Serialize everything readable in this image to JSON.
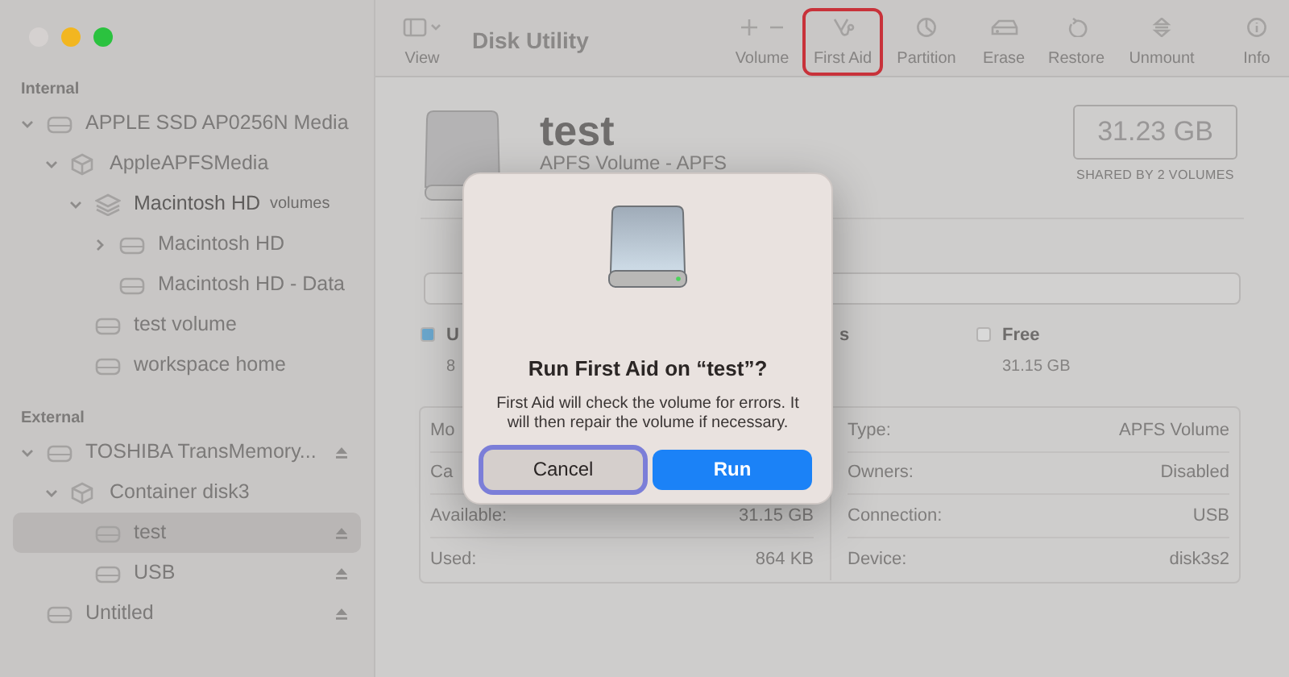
{
  "window": {
    "title": "Disk Utility",
    "controls": [
      {
        "color": "#d5d1d0"
      },
      {
        "color": "#f2b620"
      },
      {
        "color": "#2bc23f"
      }
    ]
  },
  "toolbar": {
    "view_label": "View",
    "buttons": [
      {
        "kind": "volume",
        "label": "Volume",
        "highlighted": false
      },
      {
        "kind": "first-aid",
        "label": "First Aid",
        "highlighted": true
      },
      {
        "kind": "partition",
        "label": "Partition",
        "highlighted": false
      },
      {
        "kind": "erase",
        "label": "Erase",
        "highlighted": false
      },
      {
        "kind": "restore",
        "label": "Restore",
        "highlighted": false
      },
      {
        "kind": "unmount",
        "label": "Unmount",
        "highlighted": false
      },
      {
        "kind": "info",
        "label": "Info",
        "highlighted": false
      }
    ]
  },
  "sidebar": {
    "sections": [
      {
        "title": "Internal",
        "items": [
          {
            "label": "APPLE SSD AP0256N Media",
            "kind": "drive",
            "expanded": true,
            "selected": false,
            "children": [
              {
                "label": "AppleAPFSMedia",
                "kind": "container",
                "expanded": true,
                "selected": false,
                "children": [
                  {
                    "label": "Macintosh HD",
                    "note": "volumes",
                    "kind": "group",
                    "expanded": true,
                    "selected": false,
                    "children": [
                      {
                        "label": "Macintosh HD",
                        "kind": "drive",
                        "expanded": false,
                        "selected": false
                      },
                      {
                        "label": "Macintosh HD - Data",
                        "kind": "drive",
                        "selected": false
                      }
                    ]
                  },
                  {
                    "label": "test volume",
                    "kind": "drive",
                    "selected": false
                  },
                  {
                    "label": "workspace home",
                    "kind": "drive",
                    "selected": false
                  }
                ]
              }
            ]
          }
        ]
      },
      {
        "title": "External",
        "items": [
          {
            "label": "TOSHIBA TransMemory...",
            "kind": "drive",
            "expanded": true,
            "ejectable": true,
            "selected": false,
            "children": [
              {
                "label": "Container disk3",
                "kind": "container",
                "expanded": true,
                "selected": false,
                "children": [
                  {
                    "label": "test",
                    "kind": "drive",
                    "ejectable": true,
                    "selected": true
                  },
                  {
                    "label": "USB",
                    "kind": "drive",
                    "ejectable": true,
                    "selected": false
                  }
                ]
              }
            ]
          },
          {
            "label": "Untitled",
            "kind": "drive",
            "ejectable": true,
            "selected": false
          }
        ]
      }
    ]
  },
  "volume": {
    "name": "test",
    "subtitle": "APFS Volume - APFS",
    "capacity": "31.23 GB",
    "capacity_note": "SHARED BY 2 VOLUMES",
    "legend": [
      {
        "label": "U",
        "value": "8",
        "color": "#6aa6cc"
      },
      {
        "label": "s"
      },
      {
        "label": "Free",
        "value": "31.15 GB",
        "color": "#d9d9d9"
      }
    ],
    "details_left": [
      {
        "label": "Mo"
      },
      {
        "label": "Ca"
      },
      {
        "label": "Available:",
        "value": "31.15 GB"
      },
      {
        "label": "Used:",
        "value": "864 KB"
      }
    ],
    "details_right": [
      {
        "label": "Type:",
        "value": "APFS Volume"
      },
      {
        "label": "Owners:",
        "value": "Disabled"
      },
      {
        "label": "Connection:",
        "value": "USB"
      },
      {
        "label": "Device:",
        "value": "disk3s2"
      }
    ]
  },
  "dialog": {
    "title": "Run First Aid on “test”?",
    "message": "First Aid will check the volume for errors. It will then repair the volume if necessary.",
    "buttons": [
      {
        "label": "Cancel",
        "kind": "secondary",
        "focused": true
      },
      {
        "label": "Run",
        "kind": "primary",
        "focused": false
      }
    ]
  }
}
